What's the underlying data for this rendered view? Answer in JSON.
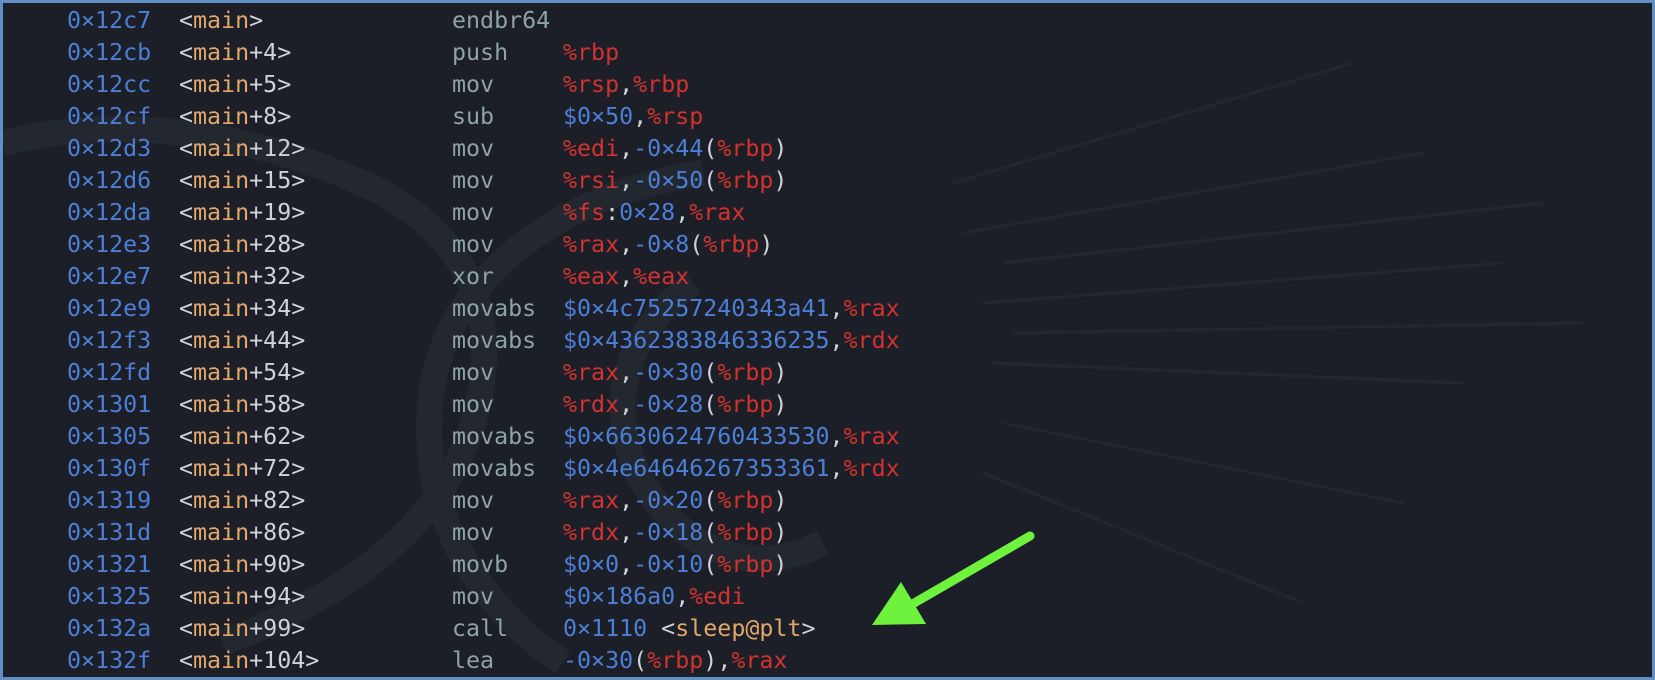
{
  "colors": {
    "border": "#5f8fc4",
    "background": "#1c1f27",
    "address": "#4c7fd6",
    "symbol": "#e0a86a",
    "register": "#d2332f",
    "immediate": "#4c7fd6",
    "mnemonic": "#8ea3a8",
    "punctuation": "#cfd2d8",
    "arrow": "#6ef23d"
  },
  "annotation": {
    "icon": "green-arrow-icon",
    "points_to_row": 19
  },
  "rows": [
    {
      "addr": "0×12c7",
      "fn": "main",
      "off": "",
      "op": "endbr64",
      "args": []
    },
    {
      "addr": "0×12cb",
      "fn": "main",
      "off": "+4",
      "op": "push",
      "args": [
        {
          "t": "%rbp",
          "k": "reg"
        }
      ]
    },
    {
      "addr": "0×12cc",
      "fn": "main",
      "off": "+5",
      "op": "mov",
      "args": [
        {
          "t": "%rsp",
          "k": "reg"
        },
        {
          "t": ",",
          "k": "pun"
        },
        {
          "t": "%rbp",
          "k": "reg"
        }
      ]
    },
    {
      "addr": "0×12cf",
      "fn": "main",
      "off": "+8",
      "op": "sub",
      "args": [
        {
          "t": "$0×50",
          "k": "num"
        },
        {
          "t": ",",
          "k": "pun"
        },
        {
          "t": "%rsp",
          "k": "reg"
        }
      ]
    },
    {
      "addr": "0×12d3",
      "fn": "main",
      "off": "+12",
      "op": "mov",
      "args": [
        {
          "t": "%edi",
          "k": "reg"
        },
        {
          "t": ",",
          "k": "pun"
        },
        {
          "t": "-0×44",
          "k": "num"
        },
        {
          "t": "(",
          "k": "pun"
        },
        {
          "t": "%rbp",
          "k": "reg"
        },
        {
          "t": ")",
          "k": "pun"
        }
      ]
    },
    {
      "addr": "0×12d6",
      "fn": "main",
      "off": "+15",
      "op": "mov",
      "args": [
        {
          "t": "%rsi",
          "k": "reg"
        },
        {
          "t": ",",
          "k": "pun"
        },
        {
          "t": "-0×50",
          "k": "num"
        },
        {
          "t": "(",
          "k": "pun"
        },
        {
          "t": "%rbp",
          "k": "reg"
        },
        {
          "t": ")",
          "k": "pun"
        }
      ]
    },
    {
      "addr": "0×12da",
      "fn": "main",
      "off": "+19",
      "op": "mov",
      "args": [
        {
          "t": "%fs",
          "k": "reg"
        },
        {
          "t": ":",
          "k": "pun"
        },
        {
          "t": "0×28",
          "k": "num"
        },
        {
          "t": ",",
          "k": "pun"
        },
        {
          "t": "%rax",
          "k": "reg"
        }
      ]
    },
    {
      "addr": "0×12e3",
      "fn": "main",
      "off": "+28",
      "op": "mov",
      "args": [
        {
          "t": "%rax",
          "k": "reg"
        },
        {
          "t": ",",
          "k": "pun"
        },
        {
          "t": "-0×8",
          "k": "num"
        },
        {
          "t": "(",
          "k": "pun"
        },
        {
          "t": "%rbp",
          "k": "reg"
        },
        {
          "t": ")",
          "k": "pun"
        }
      ]
    },
    {
      "addr": "0×12e7",
      "fn": "main",
      "off": "+32",
      "op": "xor",
      "args": [
        {
          "t": "%eax",
          "k": "reg"
        },
        {
          "t": ",",
          "k": "pun"
        },
        {
          "t": "%eax",
          "k": "reg"
        }
      ]
    },
    {
      "addr": "0×12e9",
      "fn": "main",
      "off": "+34",
      "op": "movabs",
      "args": [
        {
          "t": "$0×4c75257240343a41",
          "k": "num"
        },
        {
          "t": ",",
          "k": "pun"
        },
        {
          "t": "%rax",
          "k": "reg"
        }
      ]
    },
    {
      "addr": "0×12f3",
      "fn": "main",
      "off": "+44",
      "op": "movabs",
      "args": [
        {
          "t": "$0×4362383846336235",
          "k": "num"
        },
        {
          "t": ",",
          "k": "pun"
        },
        {
          "t": "%rdx",
          "k": "reg"
        }
      ]
    },
    {
      "addr": "0×12fd",
      "fn": "main",
      "off": "+54",
      "op": "mov",
      "args": [
        {
          "t": "%rax",
          "k": "reg"
        },
        {
          "t": ",",
          "k": "pun"
        },
        {
          "t": "-0×30",
          "k": "num"
        },
        {
          "t": "(",
          "k": "pun"
        },
        {
          "t": "%rbp",
          "k": "reg"
        },
        {
          "t": ")",
          "k": "pun"
        }
      ]
    },
    {
      "addr": "0×1301",
      "fn": "main",
      "off": "+58",
      "op": "mov",
      "args": [
        {
          "t": "%rdx",
          "k": "reg"
        },
        {
          "t": ",",
          "k": "pun"
        },
        {
          "t": "-0×28",
          "k": "num"
        },
        {
          "t": "(",
          "k": "pun"
        },
        {
          "t": "%rbp",
          "k": "reg"
        },
        {
          "t": ")",
          "k": "pun"
        }
      ]
    },
    {
      "addr": "0×1305",
      "fn": "main",
      "off": "+62",
      "op": "movabs",
      "args": [
        {
          "t": "$0×6630624760433530",
          "k": "num"
        },
        {
          "t": ",",
          "k": "pun"
        },
        {
          "t": "%rax",
          "k": "reg"
        }
      ]
    },
    {
      "addr": "0×130f",
      "fn": "main",
      "off": "+72",
      "op": "movabs",
      "args": [
        {
          "t": "$0×4e64646267353361",
          "k": "num"
        },
        {
          "t": ",",
          "k": "pun"
        },
        {
          "t": "%rdx",
          "k": "reg"
        }
      ]
    },
    {
      "addr": "0×1319",
      "fn": "main",
      "off": "+82",
      "op": "mov",
      "args": [
        {
          "t": "%rax",
          "k": "reg"
        },
        {
          "t": ",",
          "k": "pun"
        },
        {
          "t": "-0×20",
          "k": "num"
        },
        {
          "t": "(",
          "k": "pun"
        },
        {
          "t": "%rbp",
          "k": "reg"
        },
        {
          "t": ")",
          "k": "pun"
        }
      ]
    },
    {
      "addr": "0×131d",
      "fn": "main",
      "off": "+86",
      "op": "mov",
      "args": [
        {
          "t": "%rdx",
          "k": "reg"
        },
        {
          "t": ",",
          "k": "pun"
        },
        {
          "t": "-0×18",
          "k": "num"
        },
        {
          "t": "(",
          "k": "pun"
        },
        {
          "t": "%rbp",
          "k": "reg"
        },
        {
          "t": ")",
          "k": "pun"
        }
      ]
    },
    {
      "addr": "0×1321",
      "fn": "main",
      "off": "+90",
      "op": "movb",
      "args": [
        {
          "t": "$0×0",
          "k": "num"
        },
        {
          "t": ",",
          "k": "pun"
        },
        {
          "t": "-0×10",
          "k": "num"
        },
        {
          "t": "(",
          "k": "pun"
        },
        {
          "t": "%rbp",
          "k": "reg"
        },
        {
          "t": ")",
          "k": "pun"
        }
      ]
    },
    {
      "addr": "0×1325",
      "fn": "main",
      "off": "+94",
      "op": "mov",
      "args": [
        {
          "t": "$0×186a0",
          "k": "num"
        },
        {
          "t": ",",
          "k": "pun"
        },
        {
          "t": "%edi",
          "k": "reg"
        }
      ]
    },
    {
      "addr": "0×132a",
      "fn": "main",
      "off": "+99",
      "op": "call",
      "args": [
        {
          "t": "0×1110",
          "k": "num"
        },
        {
          "t": " <",
          "k": "pun"
        },
        {
          "t": "sleep@plt",
          "k": "sym"
        },
        {
          "t": ">",
          "k": "pun"
        }
      ]
    },
    {
      "addr": "0×132f",
      "fn": "main",
      "off": "+104",
      "op": "lea",
      "args": [
        {
          "t": "-0×30",
          "k": "num"
        },
        {
          "t": "(",
          "k": "pun"
        },
        {
          "t": "%rbp",
          "k": "reg"
        },
        {
          "t": ")",
          "k": "pun"
        },
        {
          "t": ",",
          "k": "pun"
        },
        {
          "t": "%rax",
          "k": "reg"
        }
      ]
    }
  ]
}
